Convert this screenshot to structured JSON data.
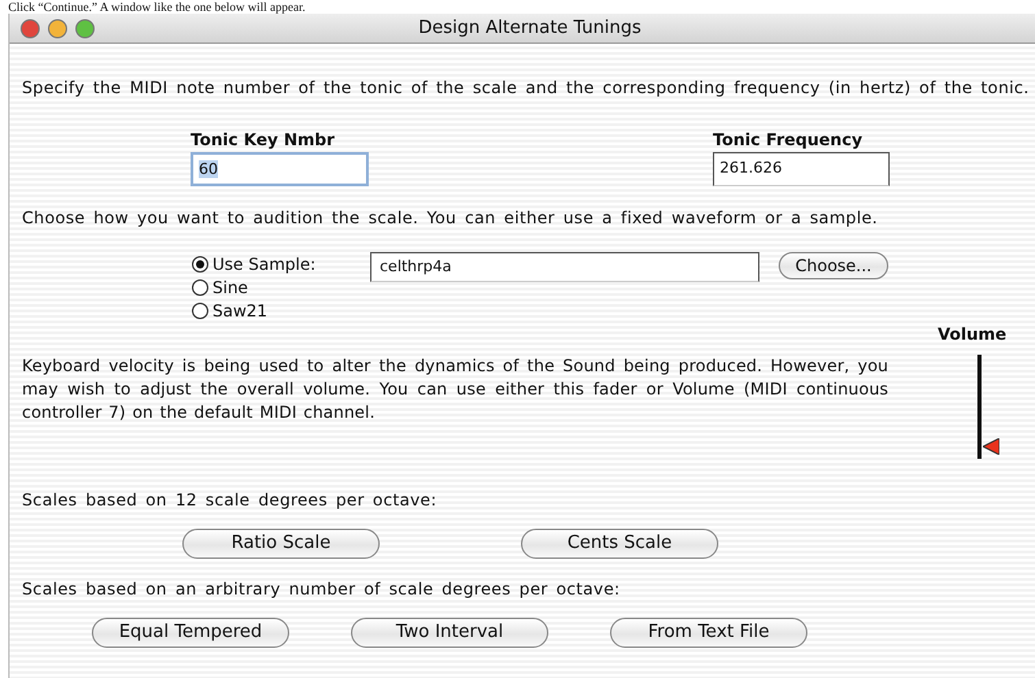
{
  "caption": "Click “Continue.” A window like the one below will appear.",
  "window": {
    "title": "Design Alternate Tunings"
  },
  "intro": "Specify the MIDI note number of the tonic of the scale and the corresponding frequency (in hertz) of the tonic.",
  "fields": [
    {
      "label": "Tonic Key Nmbr",
      "value": "60",
      "focused": true
    },
    {
      "label": "Tonic Frequency",
      "value": "261.626",
      "focused": false
    }
  ],
  "audition_prompt": "Choose how you want to audition the scale. You can either use a fixed waveform or a sample.",
  "sources": [
    {
      "label": "Use Sample:",
      "selected": true
    },
    {
      "label": "Sine",
      "selected": false
    },
    {
      "label": "Saw21",
      "selected": false
    }
  ],
  "sample": {
    "value": "celthrp4a",
    "button": "Choose..."
  },
  "volume_text": "Keyboard velocity is being used to alter the dynamics of the Sound being produced. However, you may wish to adjust the overall volume. You can use either this fader or Volume (MIDI continuous controller 7) on the default MIDI channel.",
  "volume": {
    "label": "Volume",
    "level": 0.12
  },
  "twelve_prompt": "Scales based on 12 scale degrees per octave:",
  "twelve_buttons": [
    "Ratio Scale",
    "Cents Scale"
  ],
  "arbitrary_prompt": "Scales based on an arbitrary number of scale degrees per octave:",
  "arbitrary_buttons": [
    "Equal Tempered",
    "Two Interval",
    "From Text File"
  ]
}
